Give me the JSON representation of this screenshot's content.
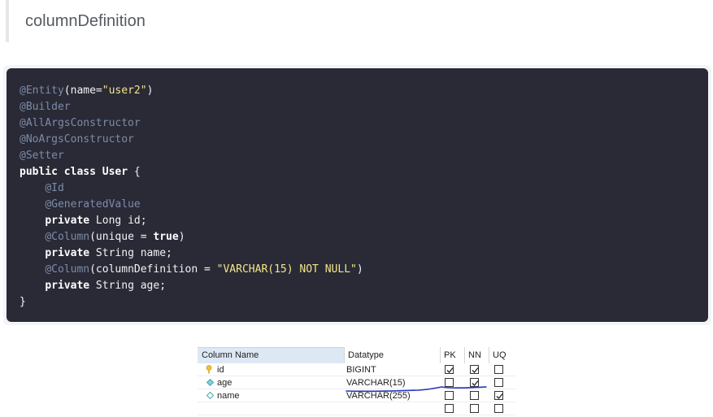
{
  "heading": {
    "title": "columnDefinition"
  },
  "code": {
    "lines": [
      [
        [
          "ann",
          "@Entity"
        ],
        [
          "txt",
          "(name="
        ],
        [
          "str",
          "\"user2\""
        ],
        [
          "txt",
          ")"
        ]
      ],
      [
        [
          "ann",
          "@Builder"
        ]
      ],
      [
        [
          "ann",
          "@AllArgsConstructor"
        ]
      ],
      [
        [
          "ann",
          "@NoArgsConstructor"
        ]
      ],
      [
        [
          "ann",
          "@Setter"
        ]
      ],
      [
        [
          "kw",
          "public"
        ],
        [
          "txt",
          " "
        ],
        [
          "kw",
          "class"
        ],
        [
          "txt",
          " "
        ],
        [
          "kw",
          "User"
        ],
        [
          "txt",
          " {"
        ]
      ],
      [
        [
          "txt",
          "    "
        ],
        [
          "ann",
          "@Id"
        ]
      ],
      [
        [
          "txt",
          "    "
        ],
        [
          "ann",
          "@GeneratedValue"
        ]
      ],
      [
        [
          "txt",
          "    "
        ],
        [
          "kw",
          "private"
        ],
        [
          "txt",
          " Long id;"
        ]
      ],
      [
        [
          "txt",
          "    "
        ],
        [
          "ann",
          "@Column"
        ],
        [
          "txt",
          "(unique = "
        ],
        [
          "kw",
          "true"
        ],
        [
          "txt",
          ")"
        ]
      ],
      [
        [
          "txt",
          "    "
        ],
        [
          "kw",
          "private"
        ],
        [
          "txt",
          " String name;"
        ]
      ],
      [
        [
          "txt",
          "    "
        ],
        [
          "ann",
          "@Column"
        ],
        [
          "txt",
          "(columnDefinition = "
        ],
        [
          "str",
          "\"VARCHAR(15) NOT NULL\""
        ],
        [
          "txt",
          ")"
        ]
      ],
      [
        [
          "txt",
          "    "
        ],
        [
          "kw",
          "private"
        ],
        [
          "txt",
          " String age;"
        ]
      ],
      [
        [
          "txt",
          "}"
        ]
      ]
    ]
  },
  "table": {
    "headers": {
      "name": "Column Name",
      "datatype": "Datatype",
      "pk": "PK",
      "nn": "NN",
      "uq": "UQ"
    },
    "rows": [
      {
        "icon": "key-icon",
        "name": "id",
        "datatype": "BIGINT",
        "pk": true,
        "nn": true,
        "uq": false
      },
      {
        "icon": "diamond-filled-icon",
        "name": "age",
        "datatype": "VARCHAR(15)",
        "pk": false,
        "nn": true,
        "uq": false
      },
      {
        "icon": "diamond-outline-icon",
        "name": "name",
        "datatype": "VARCHAR(255)",
        "pk": false,
        "nn": false,
        "uq": true
      },
      {
        "icon": "",
        "name": "",
        "datatype": "",
        "pk": false,
        "nn": false,
        "uq": false
      }
    ]
  },
  "colors": {
    "code_bg": "#292a36",
    "annotation": "#7d8ba8",
    "string": "#f3e58a",
    "header_bg": "#dde8f5",
    "pen": "#2535c0"
  }
}
